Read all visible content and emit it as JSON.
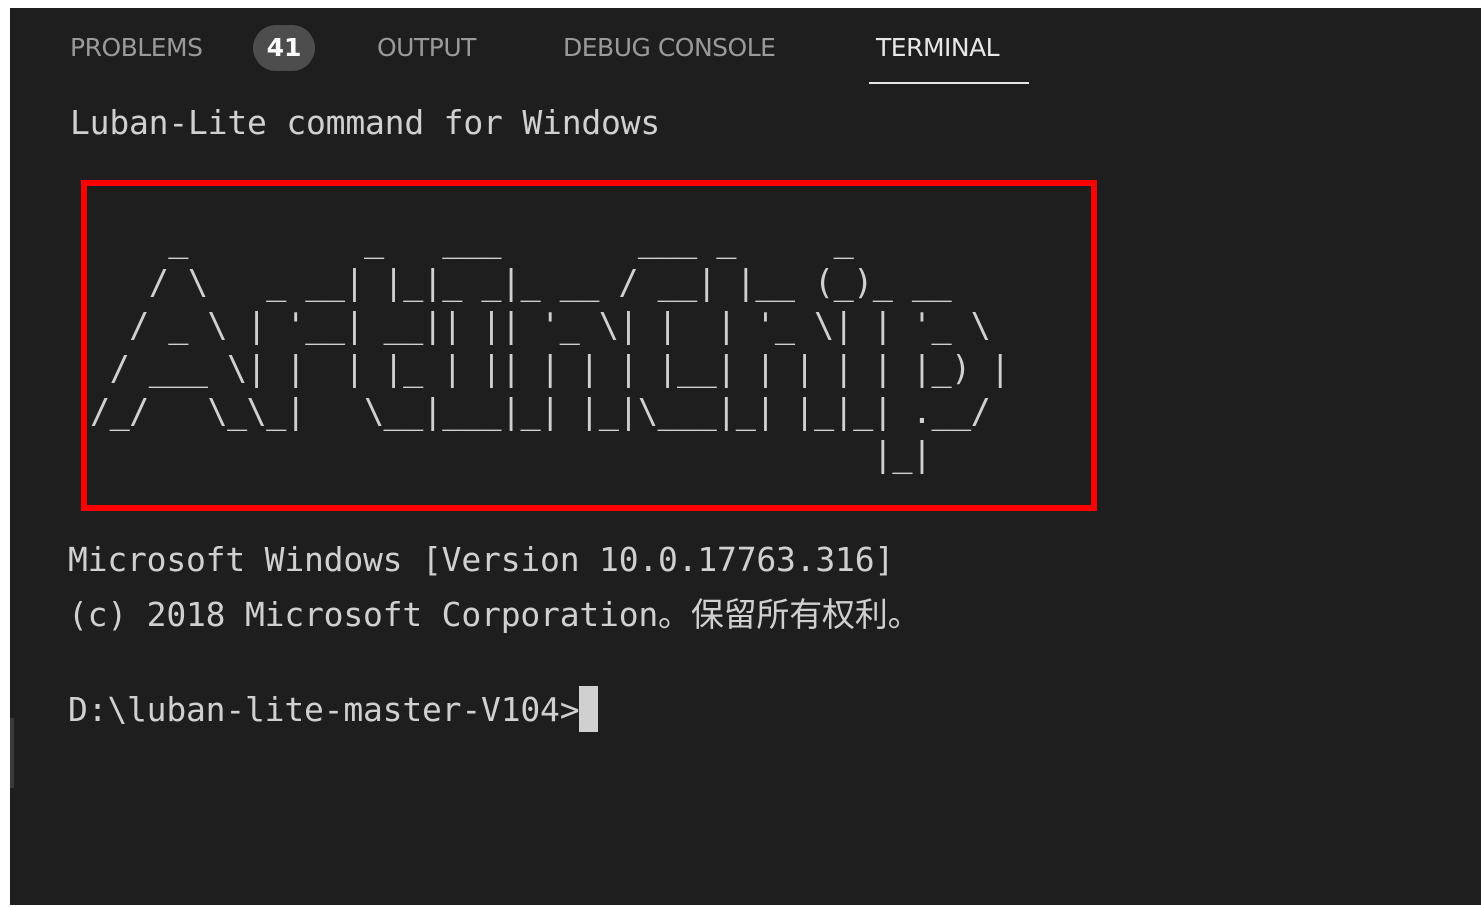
{
  "tabs": {
    "problems_label": "PROBLEMS",
    "problems_count": "41",
    "output_label": "OUTPUT",
    "debug_console_label": "DEBUG CONSOLE",
    "terminal_label": "TERMINAL",
    "active": "TERMINAL"
  },
  "terminal": {
    "header": "Luban-Lite command for Windows",
    "ascii_logo": "    _         _   ___       ___ _     _\n   / \\   _ __| |_|_ _|_ __ / __| |__ (_)_ __\n  / _ \\ | '__| __|| || '_ \\| |  | '_ \\| | '_ \\\n / ___ \\| |  | |_ | || | | | |__| | | | | |_) |\n/_/   \\_\\_|   \\__|___|_| |_|\\___|_| |_|_| .__/\n                                        |_|",
    "system_line_1": "Microsoft Windows [Version 10.0.17763.316]",
    "system_line_2": "(c) 2018 Microsoft Corporation。保留所有权利。",
    "prompt": "D:\\luban-lite-master-V104>"
  },
  "colors": {
    "background": "#1e1e1e",
    "text": "#d0d0d0",
    "highlight_border": "#ff0000",
    "badge_bg": "#4d4d4d"
  }
}
